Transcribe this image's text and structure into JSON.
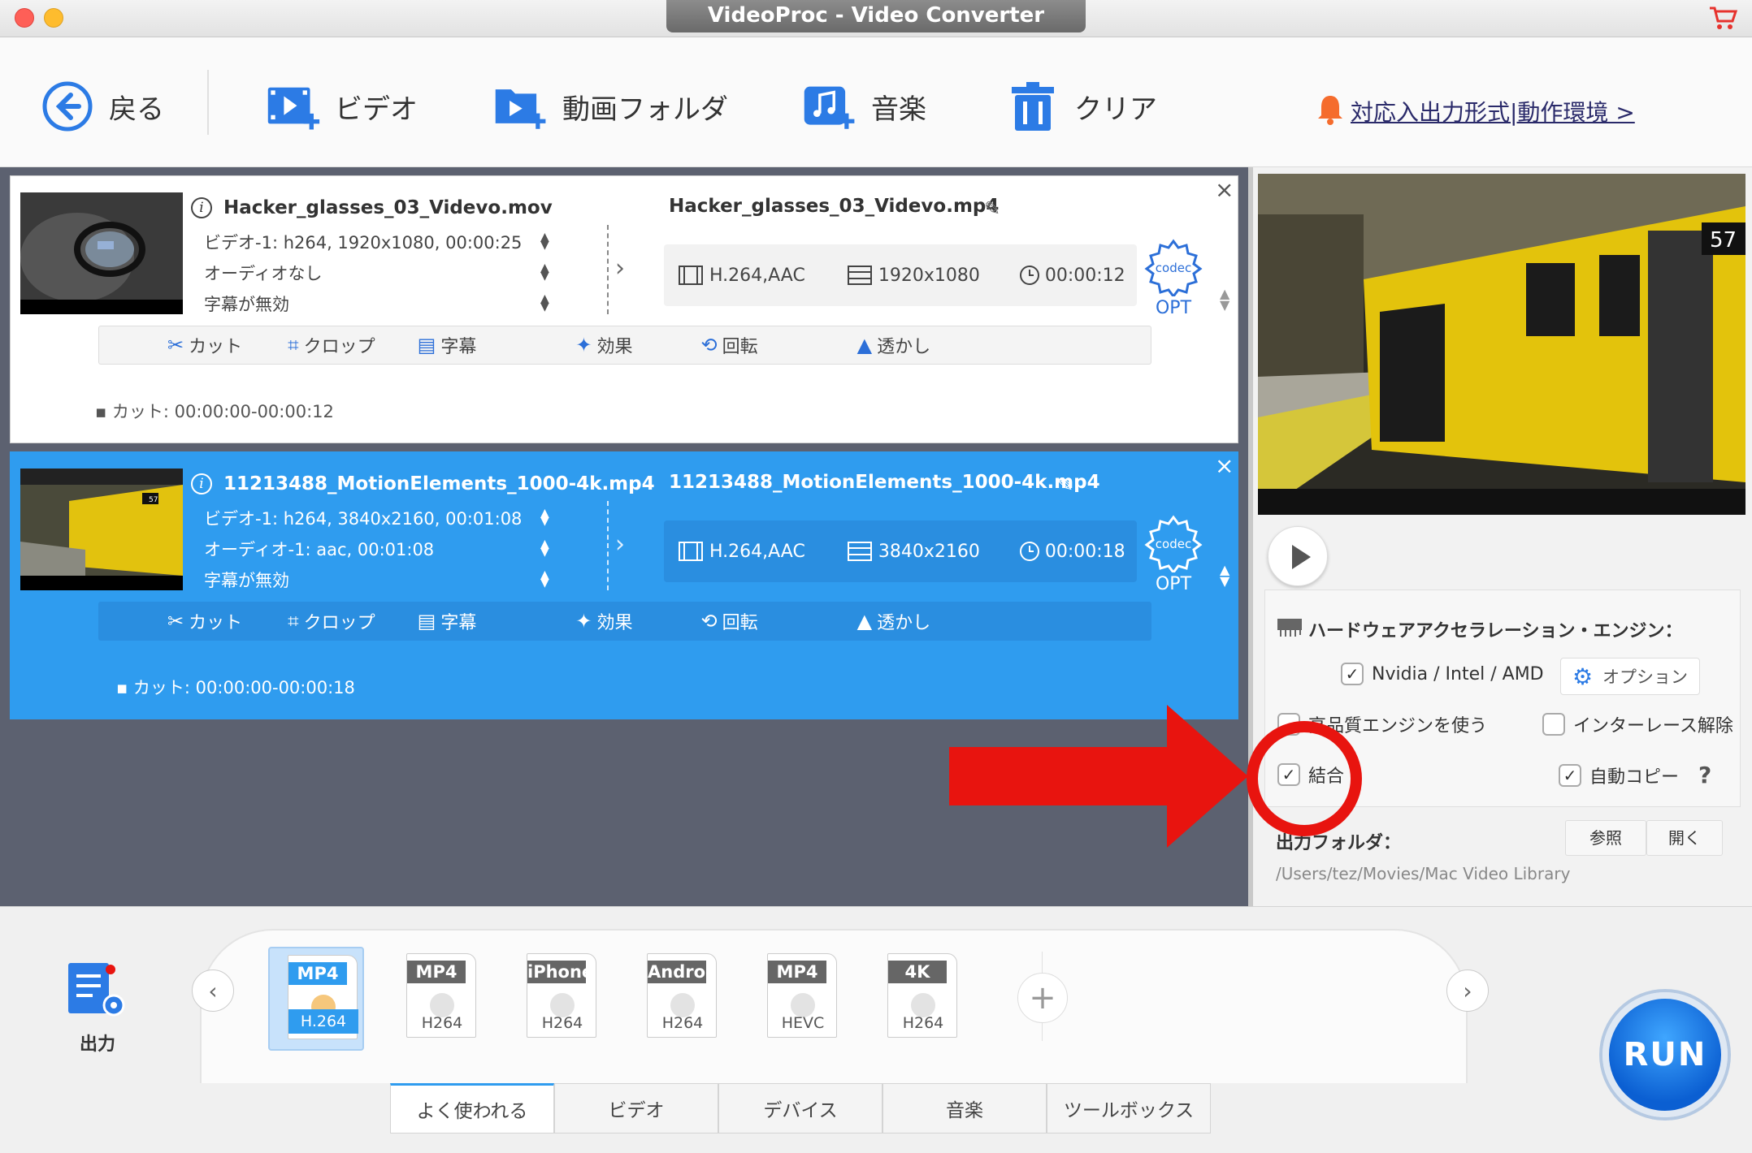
{
  "window": {
    "title": "VideoProc - Video Converter"
  },
  "toolbar": {
    "back": "戻る",
    "video": "ビデオ",
    "folder": "動画フォルダ",
    "music": "音楽",
    "clear": "クリア",
    "notice": "対応入出力形式|動作環境 >"
  },
  "files": [
    {
      "source_name": "Hacker_glasses_03_Videvo.mov",
      "video_track": "ビデオ-1: h264, 1920x1080, 00:00:25",
      "audio_track": "オーディオなし",
      "subtitle": "字幕が無効",
      "output_name": "Hacker_glasses_03_Videvo.mp4",
      "codec": "H.264,AAC",
      "resolution": "1920x1080",
      "duration": "00:00:12",
      "cut_note": "カット: 00:00:00-00:00:12",
      "selected": false
    },
    {
      "source_name": "11213488_MotionElements_1000-4k.mp4",
      "video_track": "ビデオ-1: h264, 3840x2160, 00:01:08",
      "audio_track": "オーディオ-1: aac, 00:01:08",
      "subtitle": "字幕が無効",
      "output_name": "11213488_MotionElements_1000-4k.mp4",
      "codec": "H.264,AAC",
      "resolution": "3840x2160",
      "duration": "00:00:18",
      "cut_note": "カット: 00:00:00-00:00:18",
      "selected": true
    }
  ],
  "edit": {
    "cut": "カット",
    "crop": "クロップ",
    "subtitle": "字幕",
    "effect": "効果",
    "rotate": "回転",
    "watermark": "透かし"
  },
  "codec_opt": {
    "codec": "codec",
    "opt": "OPT"
  },
  "settings": {
    "hw_title": "ハードウェアアクセラレーション・エンジン：",
    "gpu": "Nvidia /  Intel / AMD",
    "gpu_checked": true,
    "option_btn": "オプション",
    "hq_engine": "高品質エンジンを使う",
    "hq_checked": false,
    "deinterlace": "インターレース解除",
    "deinterlace_checked": false,
    "merge": "結合",
    "merge_checked": true,
    "autocopy": "自動コピー",
    "autocopy_checked": true,
    "help": "?",
    "output_folder_label": "出力フォルダ：",
    "browse": "参照",
    "open": "開く",
    "output_path": "/Users/tez/Movies/Mac Video Library"
  },
  "formats": [
    {
      "tag": "MP4",
      "sub": "H.264",
      "selected": true
    },
    {
      "tag": "MP4",
      "sub": "H264",
      "selected": false
    },
    {
      "tag": "iPhone",
      "sub": "H264",
      "selected": false
    },
    {
      "tag": "Android",
      "sub": "H264",
      "selected": false
    },
    {
      "tag": "MP4",
      "sub": "HEVC",
      "selected": false
    },
    {
      "tag": "4K",
      "sub": "H264",
      "selected": false
    }
  ],
  "output_label": "出力",
  "tabs": [
    "よく使われる",
    "ビデオ",
    "デバイス",
    "音楽",
    "ツールボックス"
  ],
  "run": "RUN",
  "colors": {
    "accent": "#2f9cef",
    "annotation": "#e8140f",
    "run": "#0b5fd2"
  }
}
